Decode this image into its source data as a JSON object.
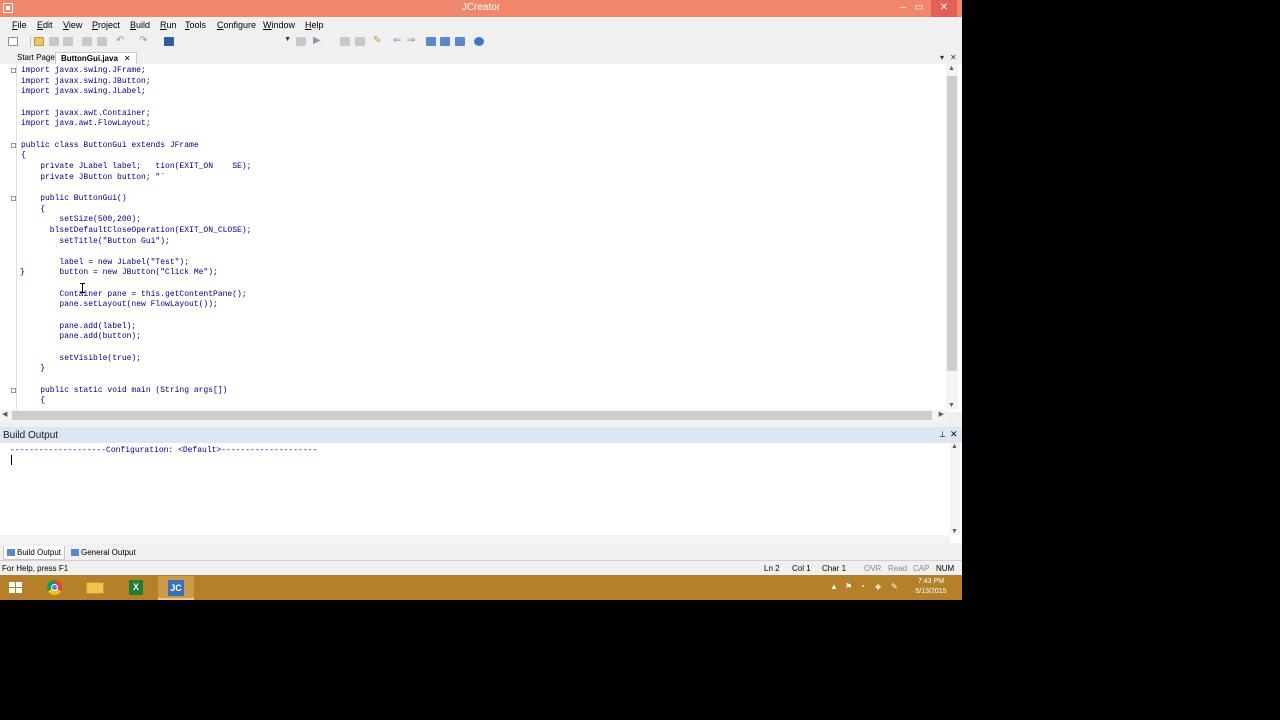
{
  "window": {
    "title": "JCreator",
    "controls": [
      "–",
      "▭",
      "✕"
    ]
  },
  "menu": [
    "File",
    "Edit",
    "View",
    "Project",
    "Build",
    "Run",
    "Tools",
    "Configure",
    "Window",
    "Help"
  ],
  "tabs": {
    "start": "Start Page",
    "file": "ButtonGui.java",
    "close": "✕",
    "list_arrow": "▾",
    "close_all": "✕"
  },
  "code": "import javax.swing.JFrame;\nimport javax.swing.JButton;\nimport javax.swing.JLabel;\n\nimport javax.awt.Container;\nimport java.awt.FlowLayout;\n\npublic class ButtonGui extends JFrame\n{\n    private JLabel label;   tion(EXIT_ON    SE);\n    private JButton button; \"`\n\n    public ButtonGui()\n    {\n        setSize(500,200);\n      blsetDefaultCloseOperation(EXIT_ON_CLOSE);\n        setTitle(\"Button Gui\");\n\n        label = new JLabel(\"Test\");\n        button = new JButton(\"Click Me\");\n\n        Container pane = this.getContentPane();\n        pane.setLayout(new FlowLayout());\n\n        pane.add(label);\n        pane.add(button);\n\n        setVisible(true);\n    }\n\n    public static void main (String args[])\n    {",
  "stray_brace": "}",
  "build_output": {
    "title": "Build Output",
    "pin": "⊥",
    "close": "✕",
    "text": "--------------------Configuration: <Default>--------------------"
  },
  "bottom_tabs": [
    "Build Output",
    "General Output"
  ],
  "status": {
    "help": "For Help, press F1",
    "ln": "Ln 2",
    "col": "Col 1",
    "char": "Char 1",
    "ovr": "OVR",
    "read": "Read",
    "cap": "CAP",
    "num": "NUM"
  },
  "taskbar": {
    "apps": [
      "Start",
      "Google Chrome",
      "File Explorer",
      "Excel",
      "JCreator"
    ],
    "time": "7:43 PM",
    "date": "5/13/2015",
    "tray_icons": [
      "show-hidden-icon",
      "flag-icon",
      "network-icon",
      "volume-icon",
      "pen-icon"
    ]
  },
  "colors": {
    "titlebar": "#f0866b",
    "taskbar": "#b4802a",
    "code": "#000080",
    "pane_header": "#dce6f4"
  }
}
